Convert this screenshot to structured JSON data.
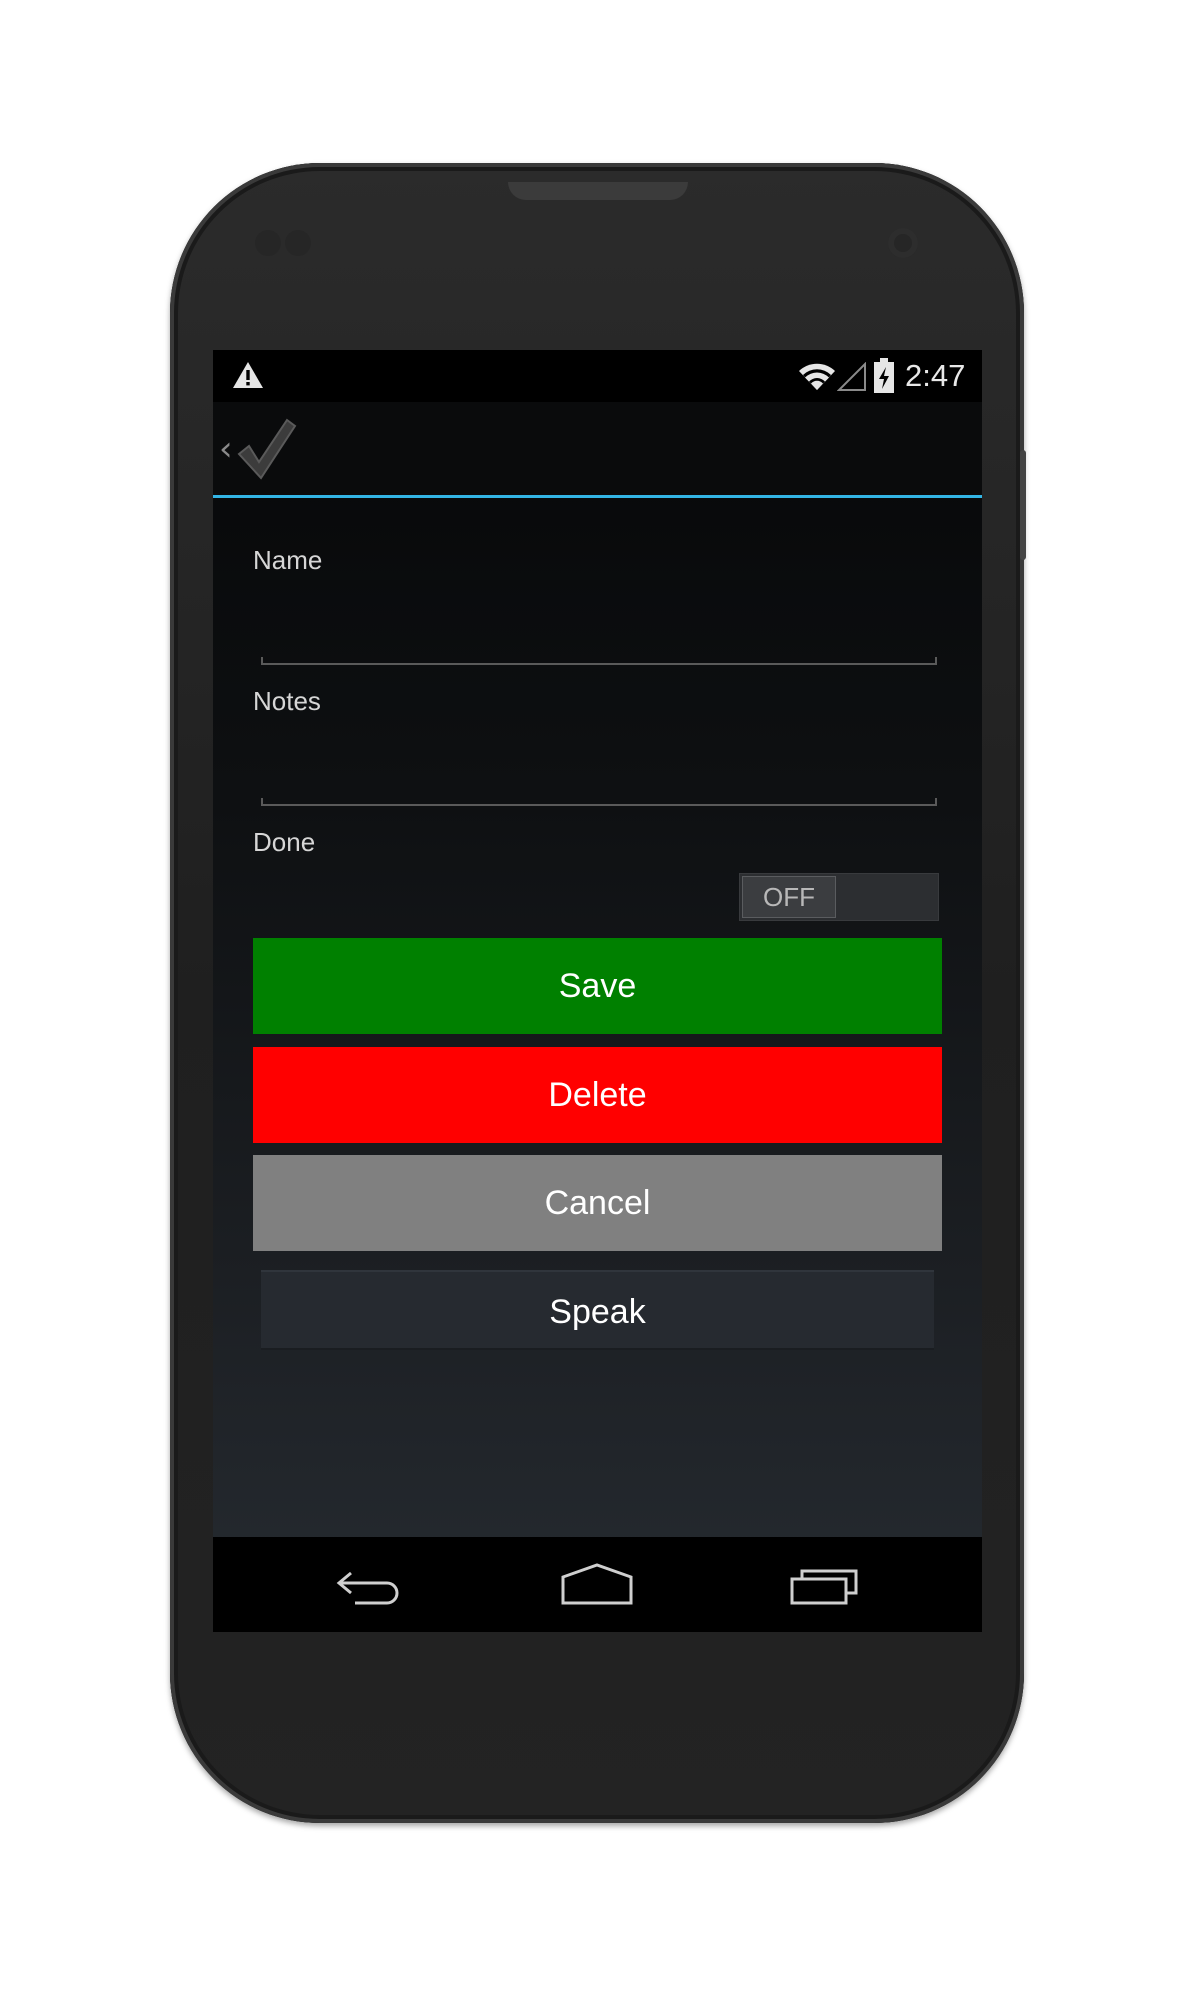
{
  "status_bar": {
    "time": "2:47",
    "icons": [
      "warning-icon",
      "wifi-icon",
      "signal-icon",
      "battery-charging-icon"
    ]
  },
  "action_bar": {
    "up_indicator": "‹",
    "app_icon": "checkmark-icon",
    "accent_color": "#33b5e5"
  },
  "form": {
    "name_label": "Name",
    "name_value": "",
    "notes_label": "Notes",
    "notes_value": "",
    "done_label": "Done",
    "done_toggle": {
      "state": "OFF",
      "checked": false
    }
  },
  "buttons": {
    "save": {
      "label": "Save",
      "color": "#008000"
    },
    "delete": {
      "label": "Delete",
      "color": "#ff0000"
    },
    "cancel": {
      "label": "Cancel",
      "color": "#808080"
    },
    "speak": {
      "label": "Speak"
    }
  },
  "nav_bar": {
    "icons": [
      "back-icon",
      "home-icon",
      "recent-apps-icon"
    ]
  }
}
